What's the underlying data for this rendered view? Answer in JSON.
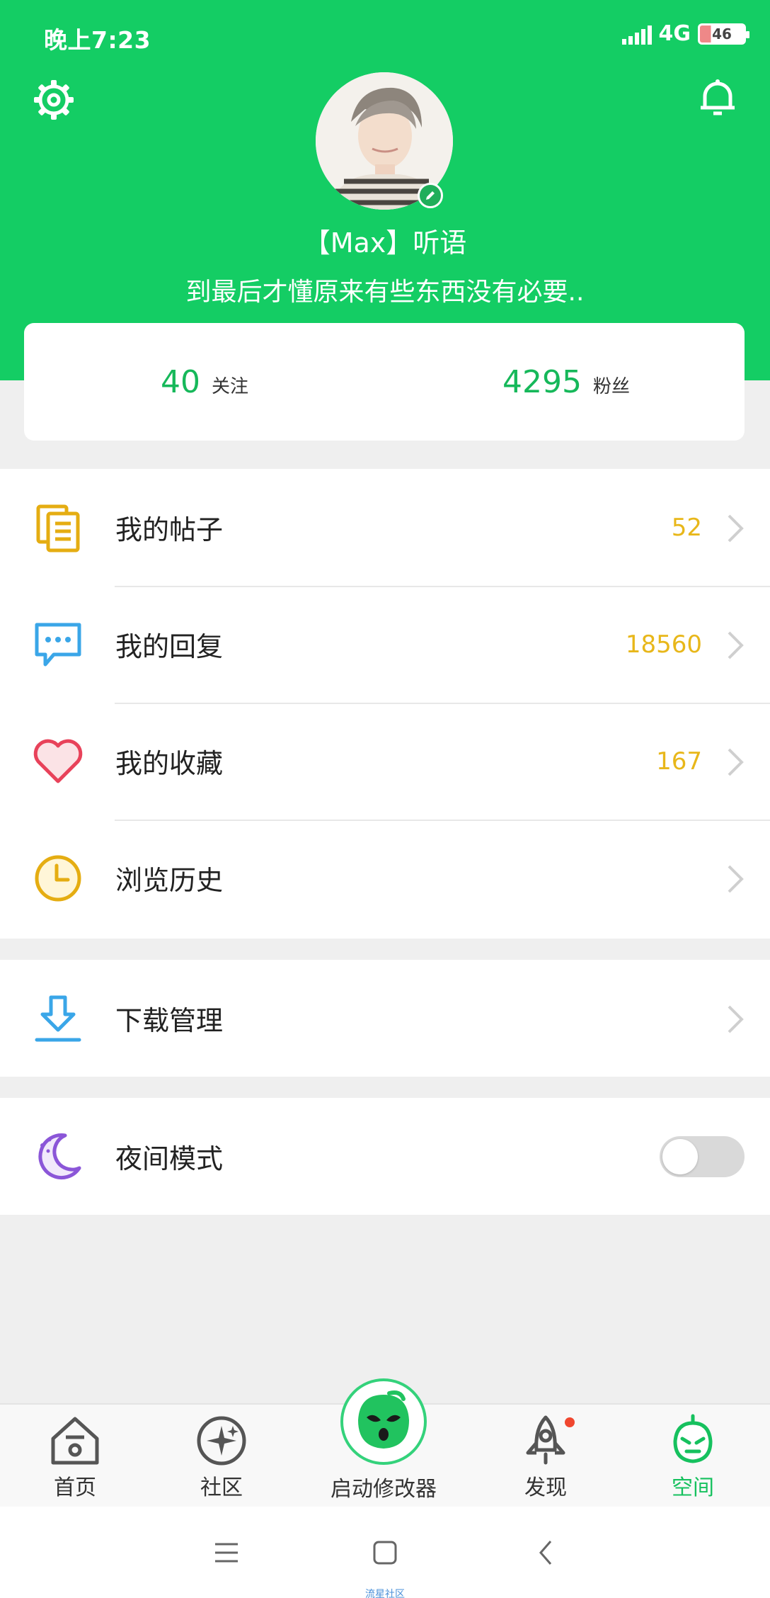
{
  "status_bar": {
    "time": "晚上7:23",
    "network": "4G",
    "battery": "46"
  },
  "profile": {
    "username": "【Max】听语",
    "signature": "到最后才懂原来有些东西没有必要.."
  },
  "stats": {
    "following_count": "40",
    "following_label": "关注",
    "fans_count": "4295",
    "fans_label": "粉丝"
  },
  "menu": {
    "posts": {
      "label": "我的帖子",
      "count": "52",
      "icon": "document-icon"
    },
    "replies": {
      "label": "我的回复",
      "count": "18560",
      "icon": "chat-bubble-icon"
    },
    "favorites": {
      "label": "我的收藏",
      "count": "167",
      "icon": "heart-icon"
    },
    "history": {
      "label": "浏览历史",
      "icon": "clock-icon"
    },
    "downloads": {
      "label": "下载管理",
      "icon": "download-icon"
    },
    "night_mode": {
      "label": "夜间模式",
      "icon": "moon-icon",
      "enabled": false
    }
  },
  "tabbar": {
    "home": "首页",
    "community": "社区",
    "launch": "启动修改器",
    "discover": "发现",
    "space": "空间"
  },
  "colors": {
    "brand_green": "#14cd64",
    "count_yellow": "#e8b71a"
  },
  "watermark": "流星社区"
}
